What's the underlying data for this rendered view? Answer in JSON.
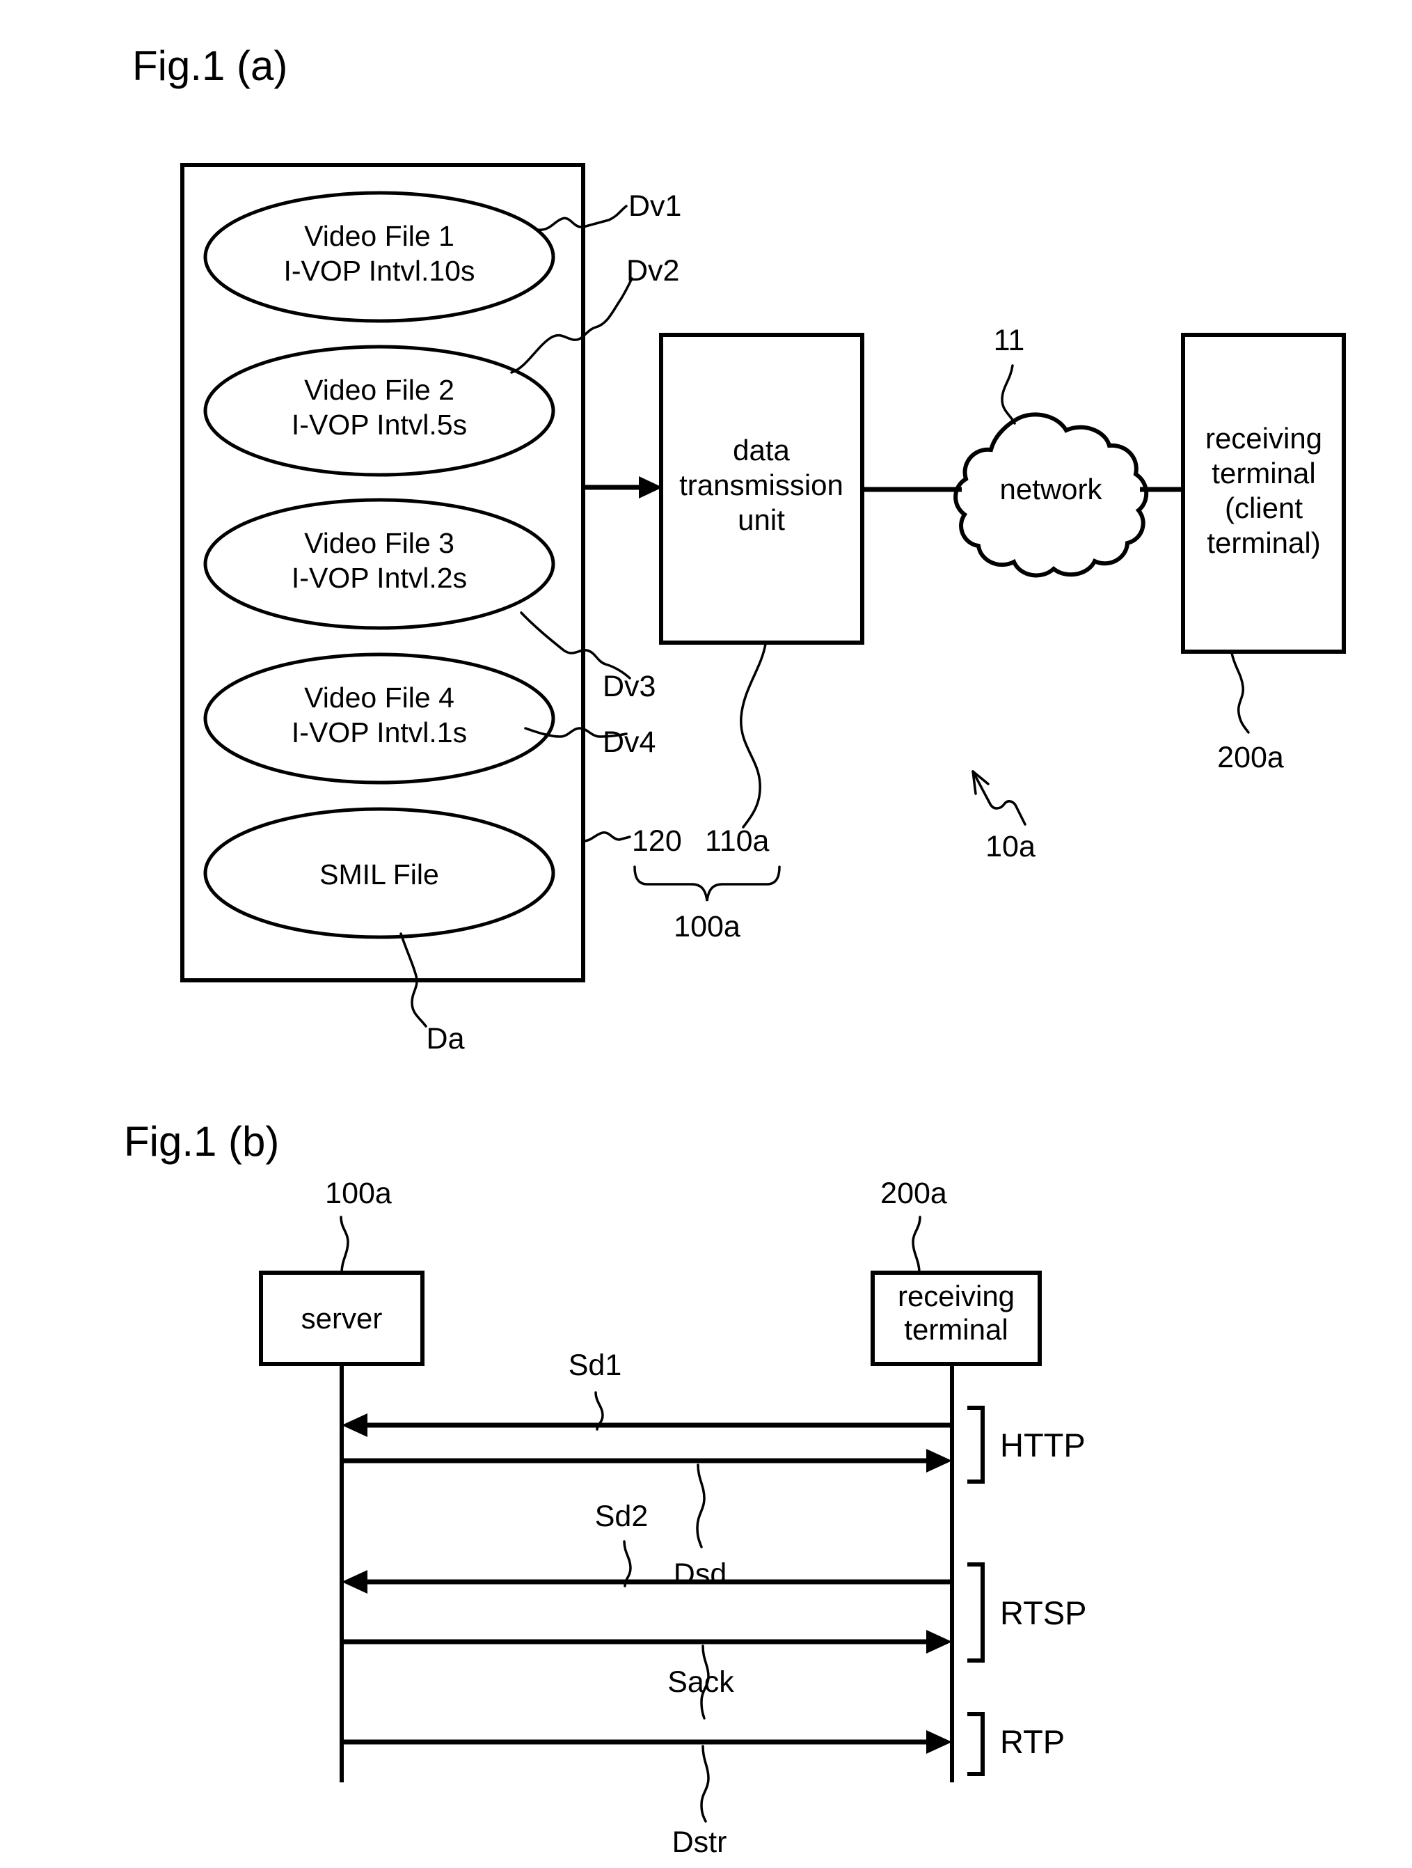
{
  "figures": [
    {
      "id": "fig-1a",
      "title": "Fig.1 (a)",
      "storage_files": [
        {
          "line1": "Video File 1",
          "line2": "I-VOP Intvl.10s",
          "ref": "Dv1"
        },
        {
          "line1": "Video File 2",
          "line2": "I-VOP Intvl.5s",
          "ref": "Dv2"
        },
        {
          "line1": "Video File 3",
          "line2": "I-VOP Intvl.2s",
          "ref": "Dv3"
        },
        {
          "line1": "Video File 4",
          "line2": "I-VOP Intvl.1s",
          "ref": "Dv4"
        },
        {
          "line1": "SMIL File",
          "line2": "",
          "ref": "Da"
        }
      ],
      "nodes": {
        "data_transmission_unit": {
          "line1": "data",
          "line2": "transmission",
          "line3": "unit",
          "ref": "110a"
        },
        "network": {
          "label": "network",
          "ref": "11"
        },
        "receiving_terminal": {
          "line1": "receiving",
          "line2": "terminal",
          "line3": "(client",
          "line4": "terminal)",
          "ref": "200a"
        }
      },
      "refs": {
        "storage": "120",
        "server": "100a",
        "system": "10a",
        "storage_data": "Da"
      }
    },
    {
      "id": "fig-1b",
      "title": "Fig.1 (b)",
      "actors": [
        {
          "label": "server",
          "ref": "100a"
        },
        {
          "line1": "receiving",
          "line2": "terminal",
          "ref": "200a"
        }
      ],
      "messages": [
        {
          "ref": "Sd1",
          "direction": "left"
        },
        {
          "ref": "Dsd",
          "direction": "right"
        },
        {
          "ref": "Sd2",
          "direction": "left"
        },
        {
          "ref": "Sack",
          "direction": "right"
        },
        {
          "ref": "Dstr",
          "direction": "right"
        }
      ],
      "protocol_brackets": [
        {
          "label": "HTTP"
        },
        {
          "label": "RTSP"
        },
        {
          "label": "RTP"
        }
      ]
    }
  ],
  "labels": {
    "fig_a_title": "Fig.1 (a)",
    "fig_b_title": "Fig.1 (b)",
    "vf1_l1": "Video File 1",
    "vf1_l2": "I-VOP Intvl.10s",
    "vf2_l1": "Video File 2",
    "vf2_l2": "I-VOP Intvl.5s",
    "vf3_l1": "Video File 3",
    "vf3_l2": "I-VOP Intvl.2s",
    "vf4_l1": "Video File 4",
    "vf4_l2": "I-VOP Intvl.1s",
    "smil": "SMIL File",
    "dv1": "Dv1",
    "dv2": "Dv2",
    "dv3": "Dv3",
    "dv4": "Dv4",
    "da": "Da",
    "dtu_l1": "data",
    "dtu_l2": "transmission",
    "dtu_l3": "unit",
    "network": "network",
    "rt_l1": "receiving",
    "rt_l2": "terminal",
    "rt_l3": "(client",
    "rt_l4": "terminal)",
    "ref_11": "11",
    "ref_120": "120",
    "ref_110a": "110a",
    "ref_100a": "100a",
    "ref_200a": "200a",
    "ref_10a": "10a",
    "server": "server",
    "b_100a": "100a",
    "b_200a": "200a",
    "b_rt_l1": "receiving",
    "b_rt_l2": "terminal",
    "sd1": "Sd1",
    "sd2": "Sd2",
    "dsd": "Dsd",
    "sack": "Sack",
    "dstr": "Dstr",
    "http": "HTTP",
    "rtsp": "RTSP",
    "rtp": "RTP"
  },
  "colors": {
    "ink": "#000000",
    "paper": "#ffffff"
  }
}
